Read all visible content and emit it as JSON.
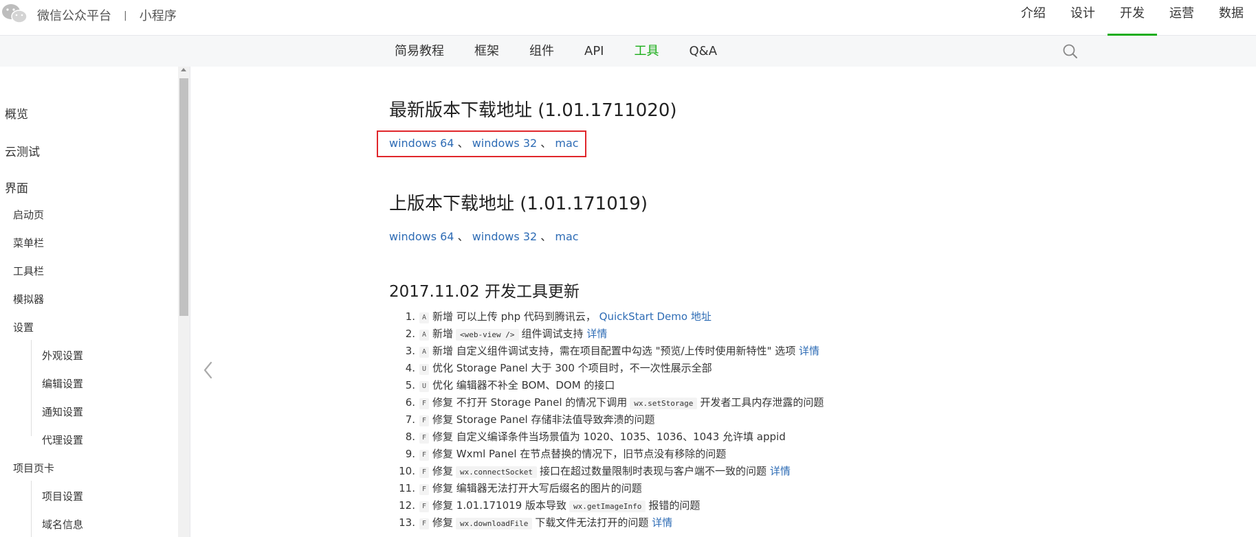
{
  "header": {
    "brand": "微信公众平台",
    "separator": "|",
    "product": "小程序",
    "nav": [
      {
        "label": "介绍"
      },
      {
        "label": "设计"
      },
      {
        "label": "开发"
      },
      {
        "label": "运营"
      },
      {
        "label": "数据"
      }
    ],
    "active_nav": "开发",
    "accent_color": "#1aad19"
  },
  "subnav": {
    "tabs": [
      {
        "label": "简易教程"
      },
      {
        "label": "框架"
      },
      {
        "label": "组件"
      },
      {
        "label": "API"
      },
      {
        "label": "工具"
      },
      {
        "label": "Q&A"
      }
    ],
    "active_tab": "工具",
    "search_icon": "search-icon"
  },
  "sidebar": {
    "items": [
      {
        "label": "概览"
      },
      {
        "label": "云测试"
      },
      {
        "label": "界面"
      },
      {
        "label": "启动页"
      },
      {
        "label": "菜单栏"
      },
      {
        "label": "工具栏"
      },
      {
        "label": "模拟器"
      },
      {
        "label": "设置"
      },
      {
        "label": "外观设置"
      },
      {
        "label": "编辑设置"
      },
      {
        "label": "通知设置"
      },
      {
        "label": "代理设置"
      },
      {
        "label": "项目页卡"
      },
      {
        "label": "项目设置"
      },
      {
        "label": "域名信息"
      }
    ]
  },
  "main": {
    "latest": {
      "title": "最新版本下载地址 (1.01.1711020)",
      "links": [
        "windows 64",
        "windows 32",
        "mac"
      ],
      "sep": "、"
    },
    "previous": {
      "title": "上版本下载地址 (1.01.171019)",
      "links": [
        "windows 64",
        "windows 32",
        "mac"
      ],
      "sep": "、"
    },
    "changelog_title": "2017.11.02 开发工具更新",
    "changelog": [
      {
        "num": "1.",
        "tag": "A",
        "t1": "新增 可以上传 php 代码到腾讯云，",
        "link": "QuickStart Demo 地址"
      },
      {
        "num": "2.",
        "tag": "A",
        "t1": "新增",
        "code": "<web-view />",
        "t2": "组件调试支持",
        "link": "详情"
      },
      {
        "num": "3.",
        "tag": "A",
        "t1": "新增 自定义组件调试支持，需在项目配置中勾选 \"预览/上传时使用新特性\" 选项",
        "link": "详情"
      },
      {
        "num": "4.",
        "tag": "U",
        "t1": "优化 Storage Panel 大于 300 个项目时，不一次性展示全部"
      },
      {
        "num": "5.",
        "tag": "U",
        "t1": "优化 编辑器不补全 BOM、DOM 的接口"
      },
      {
        "num": "6.",
        "tag": "F",
        "t1": "修复 不打开 Storage Panel 的情况下调用",
        "code": "wx.setStorage",
        "t2": "开发者工具内存泄露的问题"
      },
      {
        "num": "7.",
        "tag": "F",
        "t1": "修复 Storage Panel 存储非法值导致奔溃的问题"
      },
      {
        "num": "8.",
        "tag": "F",
        "t1": "修复 自定义编译条件当场景值为 1020、1035、1036、1043 允许填 appid"
      },
      {
        "num": "9.",
        "tag": "F",
        "t1": "修复 Wxml Panel 在节点替换的情况下，旧节点没有移除的问题"
      },
      {
        "num": "10.",
        "tag": "F",
        "t1": "修复",
        "code": "wx.connectSocket",
        "t2": "接口在超过数量限制时表现与客户端不一致的问题",
        "link": "详情"
      },
      {
        "num": "11.",
        "tag": "F",
        "t1": "修复 编辑器无法打开大写后缀名的图片的问题"
      },
      {
        "num": "12.",
        "tag": "F",
        "t1": "修复 1.01.171019 版本导致",
        "code": "wx.getImageInfo",
        "t2": "报错的问题"
      },
      {
        "num": "13.",
        "tag": "F",
        "t1": "修复",
        "code": "wx.downloadFile",
        "t2": "下载文件无法打开的问题",
        "link": "详情"
      }
    ]
  }
}
